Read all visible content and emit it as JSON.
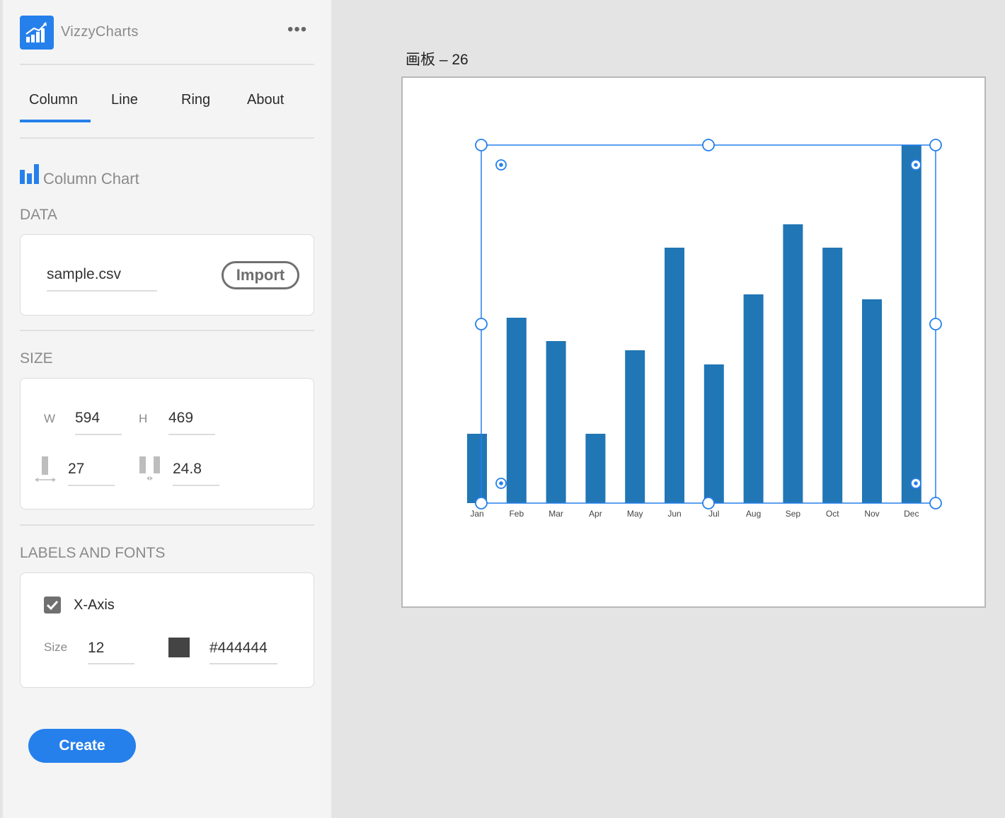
{
  "app": {
    "name": "VizzyCharts",
    "more_label": "•••"
  },
  "tabs": [
    {
      "label": "Column",
      "active": true
    },
    {
      "label": "Line"
    },
    {
      "label": "Ring"
    },
    {
      "label": "About"
    }
  ],
  "panel": {
    "title": "Column Chart",
    "icon": "bar-chart-icon",
    "data_section": {
      "label": "DATA",
      "file_name": "sample.csv",
      "import_label": "Import"
    },
    "size_section": {
      "label": "SIZE",
      "w_label": "W",
      "w_value": "594",
      "h_label": "H",
      "h_value": "469",
      "bar_width_value": "27",
      "bar_spacing_value": "24.8"
    },
    "labels_section": {
      "label": "LABELS AND FONTS",
      "xaxis_label": "X-Axis",
      "xaxis_checked": true,
      "size_label": "Size",
      "size_value": "12",
      "color_value": "#444444"
    },
    "create_label": "Create"
  },
  "canvas": {
    "artboard_title": "画板 – 26"
  },
  "colors": {
    "accent": "#2680eb",
    "bar": "#2176b5",
    "axis_text": "#444444"
  },
  "chart_data": {
    "type": "bar",
    "categories": [
      "Jan",
      "Feb",
      "Mar",
      "Apr",
      "May",
      "Jun",
      "Jul",
      "Aug",
      "Sep",
      "Oct",
      "Nov",
      "Dec"
    ],
    "values": [
      98,
      262,
      229,
      98,
      216,
      361,
      196,
      295,
      394,
      361,
      288,
      506
    ],
    "ylim": [
      0,
      506
    ],
    "xlabel": "",
    "ylabel": "",
    "grid": false,
    "legend": "none"
  }
}
